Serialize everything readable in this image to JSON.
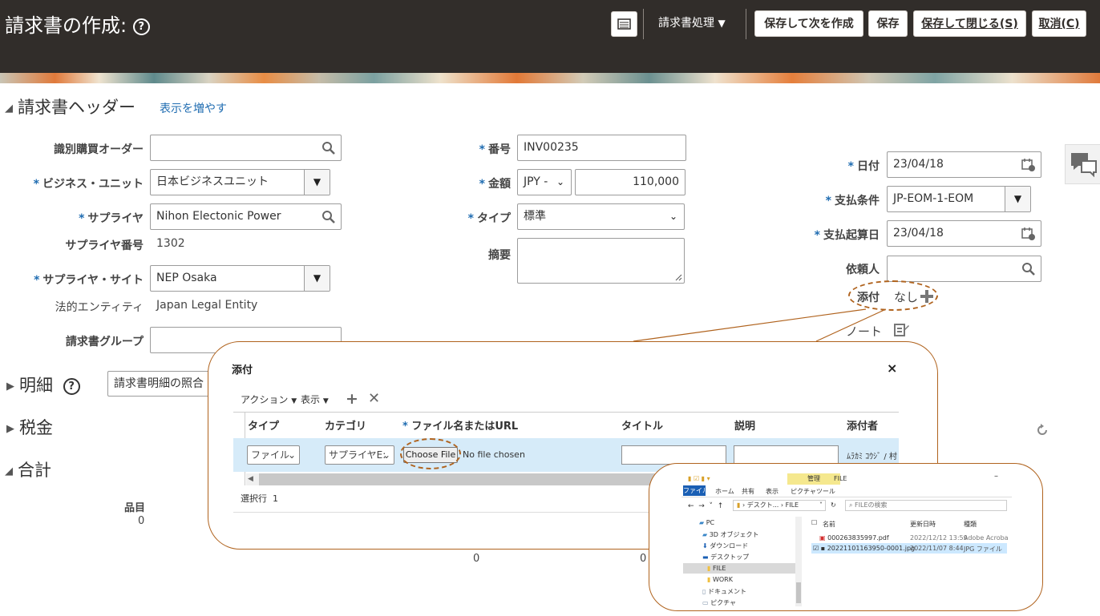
{
  "header": {
    "title": "請求書の作成:",
    "help_glyph": "?",
    "invoice_actions": "請求書処理",
    "save_and_create_next": "保存して次を作成",
    "save": "保存",
    "save_and_close": "保存して閉じる(S)",
    "cancel": "取消(C)"
  },
  "invoice_header": {
    "section_title": "請求書ヘッダー",
    "show_more": "表示を増やす",
    "fields": {
      "po_label": "識別購買オーダー",
      "po_value": "",
      "bu_label": "ビジネス・ユニット",
      "bu_value": "日本ビジネスユニット",
      "supplier_label": "サプライヤ",
      "supplier_value": "Nihon Electonic Power",
      "supplier_number_label": "サプライヤ番号",
      "supplier_number_value": "1302",
      "supplier_site_label": "サプライヤ・サイト",
      "supplier_site_value": "NEP Osaka",
      "legal_entity_label": "法的エンティティ",
      "legal_entity_value": "Japan Legal Entity",
      "invoice_group_label": "請求書グループ",
      "invoice_group_value": "",
      "number_label": "番号",
      "number_value": "INV00235",
      "amount_label": "金額",
      "currency_value": "JPY -",
      "amount_value": "110,000",
      "type_label": "タイプ",
      "type_value": "標準",
      "description_label": "摘要",
      "description_value": "",
      "date_label": "日付",
      "date_value": "23/04/18",
      "payment_terms_label": "支払条件",
      "payment_terms_value": "JP-EOM-1-EOM",
      "terms_date_label": "支払起算日",
      "terms_date_value": "23/04/18",
      "requester_label": "依頼人",
      "requester_value": "",
      "attachments_label": "添付",
      "attachments_value": "なし",
      "notes_label": "ノート"
    }
  },
  "lines": {
    "section_title": "明細",
    "match_select": "請求書明細の照合"
  },
  "taxes": {
    "section_title": "税金"
  },
  "totals": {
    "section_title": "合計",
    "items_label": "品目",
    "items_value": "0",
    "total_a": "0",
    "total_b": "0"
  },
  "attachment_dialog": {
    "title": "添付",
    "close_glyph": "×",
    "actions_menu": "アクション",
    "view_menu": "表示",
    "columns": [
      "タイプ",
      "カテゴリ",
      "ファイル名またはURL",
      "タイトル",
      "説明",
      "添付者"
    ],
    "row": {
      "type": "ファイル",
      "category": "サプライヤE:",
      "choose_file": "Choose File",
      "no_file": "No file chosen",
      "attached_by": "ﾑﾗｶﾐ ｺｳｼﾞ / 村"
    },
    "selected_rows_label": "選択行",
    "selected_rows_value": "1"
  },
  "file_explorer": {
    "manage_tab": "管理",
    "folder_title": "FILE",
    "ribbon_tabs": [
      "ファイル",
      "ホーム",
      "共有",
      "表示",
      "ピクチャツール"
    ],
    "path": [
      "デスクト...",
      "FILE"
    ],
    "search_placeholder": "FILEの検索",
    "tree": [
      "PC",
      "3D オブジェクト",
      "ダウンロード",
      "デスクトップ",
      "FILE",
      "WORK",
      "ドキュメント",
      "ピクチャ"
    ],
    "headers": {
      "name": "名前",
      "modified": "更新日時",
      "type": "種類"
    },
    "files": [
      {
        "name": "000263835997.pdf",
        "modified": "2022/12/12 13:59",
        "type": "Adobe Acrobat D"
      },
      {
        "name": "20221101163950-0001.jpg",
        "modified": "2022/11/07 8:44",
        "type": "JPG ファイル"
      }
    ]
  },
  "colors": {
    "topbar": "#312d2a",
    "accent": "#1f6cb1",
    "callout": "#b0631e",
    "selected_row": "#d6ebf9"
  }
}
